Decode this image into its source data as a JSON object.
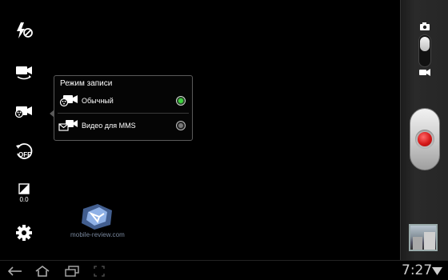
{
  "popup": {
    "title": "Режим записи",
    "options": [
      {
        "label": "Обычный",
        "selected": true,
        "icon": "video-camera-normal-icon"
      },
      {
        "label": "Видео для MMS",
        "selected": false,
        "icon": "video-mms-icon"
      }
    ]
  },
  "left_toolbar": {
    "items": [
      "flash-off-icon",
      "switch-camera-icon",
      "recording-mode-icon",
      "timer-off-icon",
      "exposure-icon",
      "settings-gear-icon"
    ],
    "timer_label": "OFF",
    "exposure_value": "0.0"
  },
  "watermark": {
    "text": "mobile-review.com"
  },
  "mode_switch": {
    "top_icon": "camera-icon",
    "bottom_icon": "video-icon",
    "selected": "camera"
  },
  "status_bar": {
    "time": "7:27"
  },
  "colors": {
    "selected_radio": "#3dd23d",
    "record": "#d51818",
    "popup_border": "#5a5a5a"
  }
}
